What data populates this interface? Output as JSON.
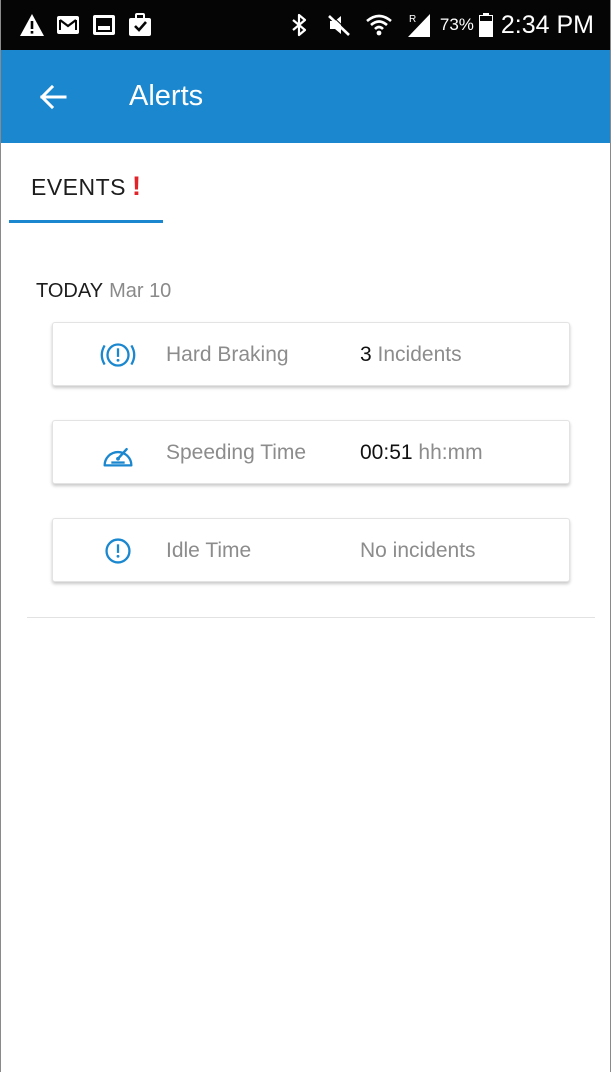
{
  "status_bar": {
    "left_icons": [
      "warning-icon",
      "mail-icon",
      "image-icon",
      "briefcase-icon"
    ],
    "right_icons": [
      "bluetooth-icon",
      "mute-icon",
      "wifi-icon",
      "signal-roaming-icon"
    ],
    "roaming_label": "R",
    "battery_percent": "73%",
    "battery_level": 0.73,
    "time": "2:34 PM"
  },
  "app_bar": {
    "title": "Alerts",
    "back_icon": "arrow-left-icon",
    "color": "#1a87cf"
  },
  "tabs": [
    {
      "label": "EVENTS",
      "alert_mark": "!",
      "active": true
    }
  ],
  "day_group": {
    "label": "TODAY",
    "date": "Mar 10"
  },
  "events": [
    {
      "icon": "brake-warning-icon",
      "label": "Hard Braking",
      "value": "3",
      "unit": "Incidents"
    },
    {
      "icon": "speedometer-icon",
      "label": "Speeding Time",
      "value": "00:51",
      "unit": "hh:mm"
    },
    {
      "icon": "alert-circle-icon",
      "label": "Idle Time",
      "value": "",
      "unit": "No incidents"
    }
  ],
  "colors": {
    "accent": "#1a87cf",
    "alert": "#e0242a",
    "muted_text": "#8c8c8c"
  }
}
